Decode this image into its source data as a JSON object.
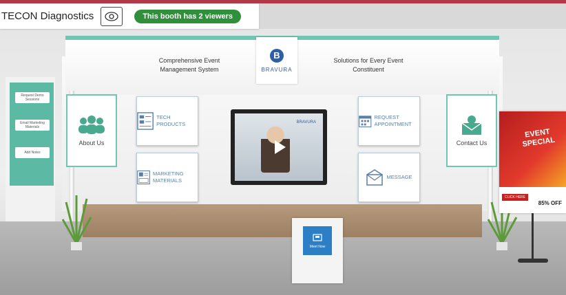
{
  "header": {
    "title": "TECON Diagnostics",
    "viewers_badge": "This booth has 2 viewers"
  },
  "booth": {
    "header_left": "Comprehensive Event Management System",
    "header_right": "Solutions for Every Event Constituent",
    "logo_letter": "B",
    "logo_name": "BRAVURA",
    "panels": {
      "about_us": "About Us",
      "products": "Tech Products",
      "marketing": "Marketing Materials",
      "request_appointment": "Request Appointment",
      "message": "Message",
      "contact_us": "Contact Us"
    },
    "kiosk_buttons": [
      "Request Demo Sessions",
      "Email Marketing Materials",
      "Add Notes"
    ],
    "video_brand": "BRAVURA",
    "counter_label": "Meet Now",
    "poster": {
      "title": "EVENT SPECIAL",
      "discount": "85% OFF",
      "cta": "CLICK HERE"
    }
  },
  "colors": {
    "accent_bar": "#b23a48",
    "viewer_badge": "#2f8f3a",
    "booth_teal": "#6fc7b3",
    "brand_blue": "#2d5fa8"
  }
}
